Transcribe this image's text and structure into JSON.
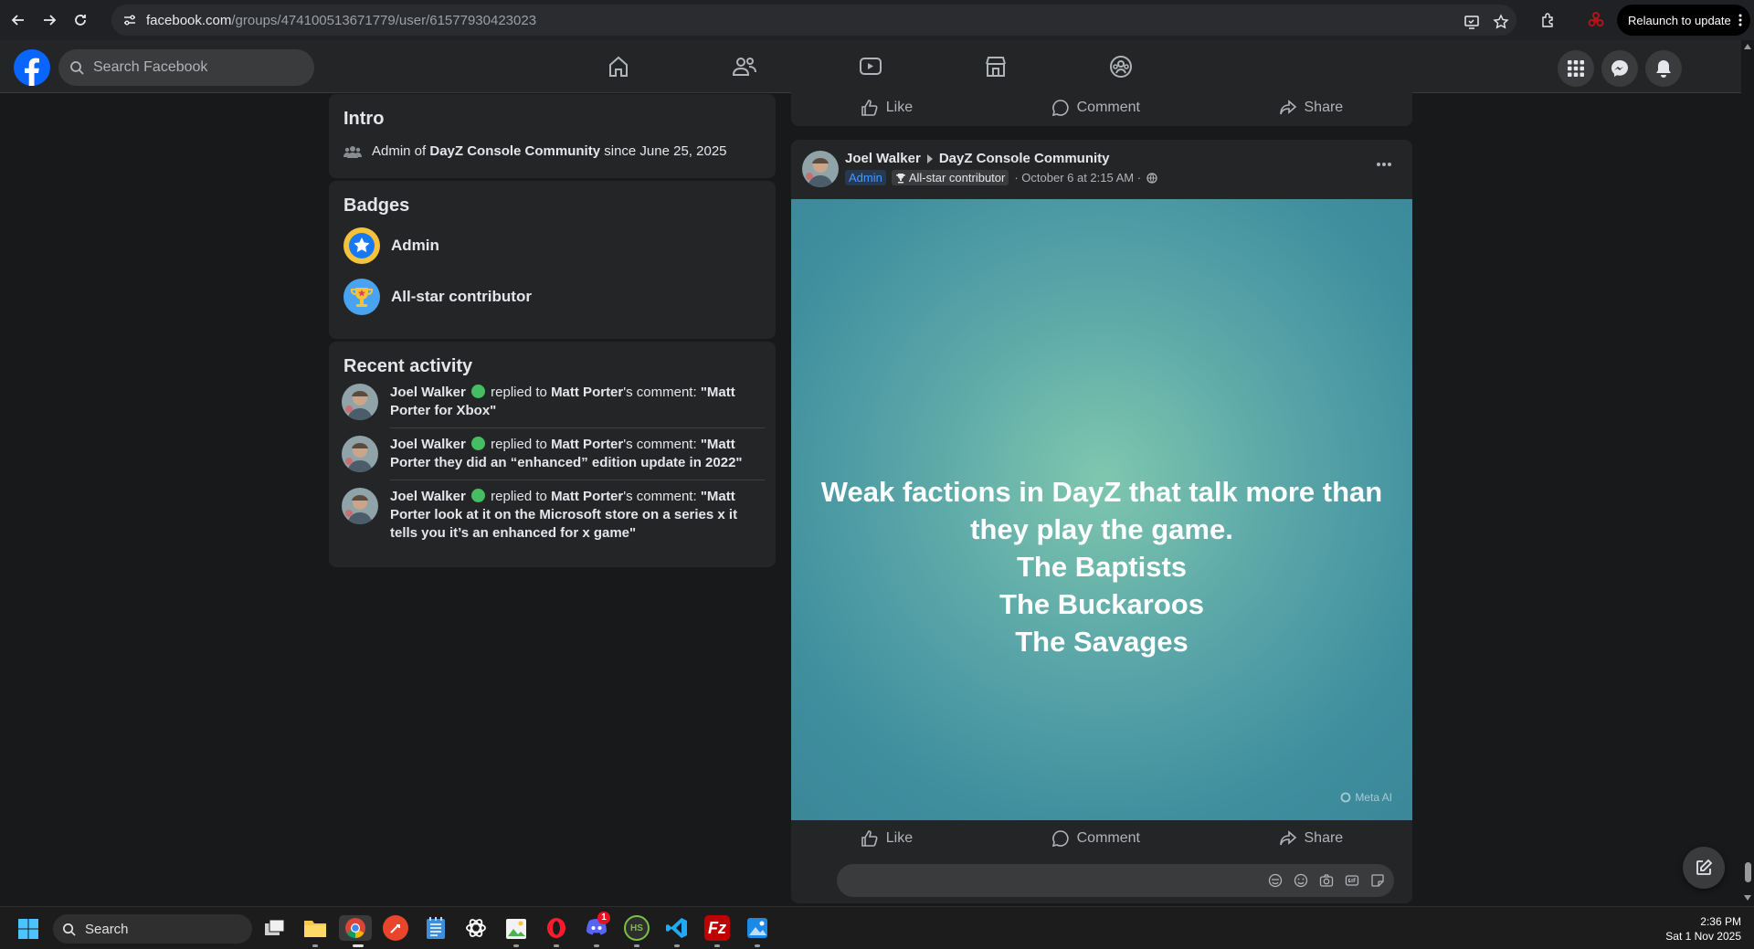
{
  "browser": {
    "url_domain": "facebook.com",
    "url_path": "/groups/474100513671779/user/61577930423023",
    "relaunch_label": "Relaunch to update"
  },
  "header": {
    "search_placeholder": "Search Facebook"
  },
  "intro": {
    "title": "Intro",
    "prefix": "Admin of",
    "group": "DayZ Console Community",
    "suffix": "since June 25, 2025"
  },
  "badges": {
    "title": "Badges",
    "items": [
      "Admin",
      "All-star contributor"
    ]
  },
  "recent": {
    "title": "Recent activity",
    "items": [
      {
        "user": "Joel Walker",
        "action": "replied to",
        "target": "Matt Porter",
        "suffix": "'s comment:",
        "quote": "\"Matt Porter for Xbox\""
      },
      {
        "user": "Joel Walker",
        "action": "replied to",
        "target": "Matt Porter",
        "suffix": "'s comment:",
        "quote": "\"Matt Porter they did an “enhanced” edition update in 2022\""
      },
      {
        "user": "Joel Walker",
        "action": "replied to",
        "target": "Matt Porter",
        "suffix": "'s comment:",
        "quote": "\"Matt Porter look at it on the Microsoft store on a series x it tells you it’s an enhanced for x game\""
      }
    ]
  },
  "actions": {
    "like": "Like",
    "comment": "Comment",
    "share": "Share"
  },
  "post": {
    "author": "Joel Walker",
    "group": "DayZ Console Community",
    "role_badge": "Admin",
    "contributor_badge": "All-star contributor",
    "timestamp": "· October 6 at 2:15 AM ·",
    "text_lines": [
      "Weak factions in DayZ that talk more than",
      "they play the game.",
      "The Baptists",
      "The Buckaroos",
      "The Savages"
    ],
    "watermark": "Meta AI"
  },
  "taskbar": {
    "search_label": "Search",
    "discord_notifications": "1",
    "time": "2:36 PM",
    "date": "Sat 1 Nov 2025"
  }
}
